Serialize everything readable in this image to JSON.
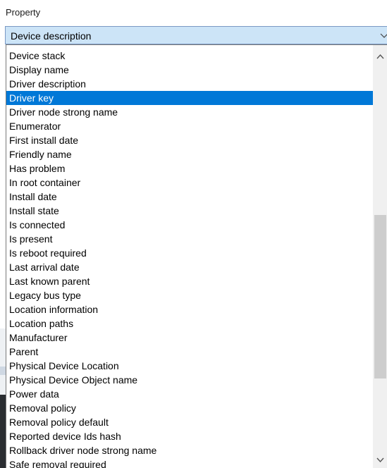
{
  "property_label": "Property",
  "combo": {
    "value": "Device description"
  },
  "list": {
    "selected_index": 3,
    "items": [
      "Device stack",
      "Display name",
      "Driver description",
      "Driver key",
      "Driver node strong name",
      "Enumerator",
      "First install date",
      "Friendly name",
      "Has problem",
      "In root container",
      "Install date",
      "Install state",
      "Is connected",
      "Is present",
      "Is reboot required",
      "Last arrival date",
      "Last known parent",
      "Legacy bus type",
      "Location information",
      "Location paths",
      "Manufacturer",
      "Parent",
      "Physical Device Location",
      "Physical Device Object name",
      "Power data",
      "Removal policy",
      "Removal policy default",
      "Reported device Ids hash",
      "Rollback driver node strong name",
      "Safe removal required"
    ]
  },
  "icons": {
    "combo_chevron": "chevron-down-icon",
    "scroll_up": "scroll-up-arrow-icon",
    "scroll_down": "scroll-down-arrow-icon"
  },
  "colors": {
    "selection": "#0078d7",
    "combo_background": "#cce4f7",
    "combo_border": "#7a99c4",
    "scrollbar_thumb": "#cdcdcd"
  }
}
